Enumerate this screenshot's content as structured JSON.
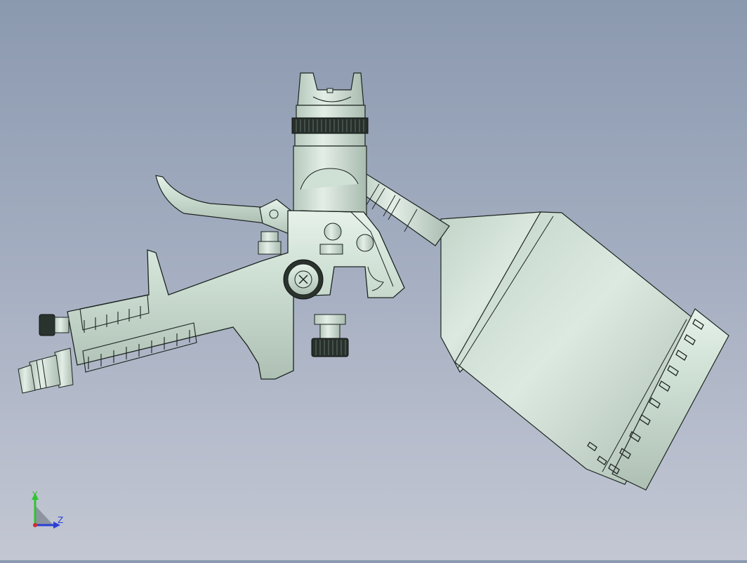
{
  "viewport": {
    "background_top": "#8b99af",
    "background_bottom": "#c3c7d3",
    "model_color": "#cfe0d4",
    "edge_color": "#1c2420"
  },
  "triad": {
    "y_label": "Y",
    "z_label": "Z",
    "y_color": "#2ec52e",
    "z_color": "#2a3fd6",
    "x_color": "#d42a2a"
  }
}
